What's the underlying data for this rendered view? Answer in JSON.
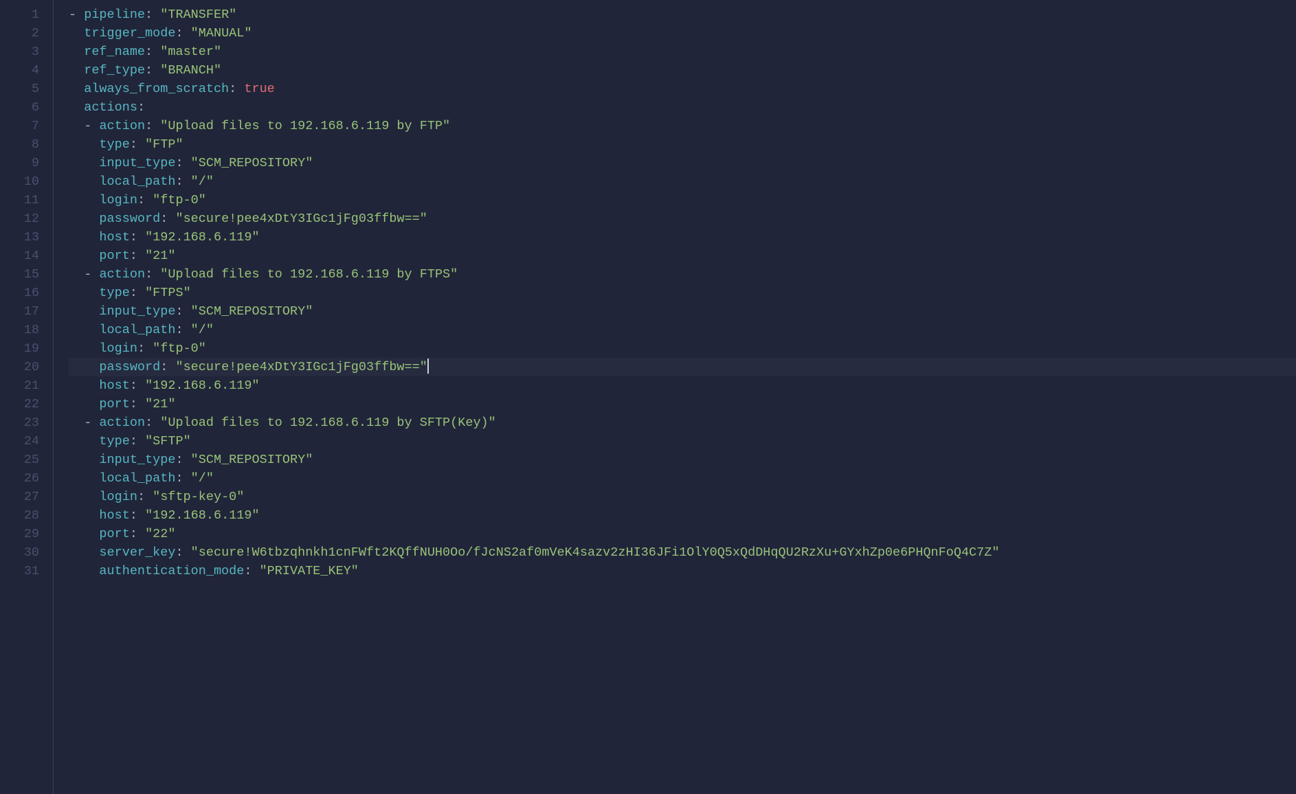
{
  "active_line": 20,
  "lines": [
    {
      "n": 1,
      "indent": 0,
      "dash": true,
      "key": "pipeline",
      "type": "str",
      "val": "TRANSFER"
    },
    {
      "n": 2,
      "indent": 1,
      "dash": false,
      "key": "trigger_mode",
      "type": "str",
      "val": "MANUAL"
    },
    {
      "n": 3,
      "indent": 1,
      "dash": false,
      "key": "ref_name",
      "type": "str",
      "val": "master"
    },
    {
      "n": 4,
      "indent": 1,
      "dash": false,
      "key": "ref_type",
      "type": "str",
      "val": "BRANCH"
    },
    {
      "n": 5,
      "indent": 1,
      "dash": false,
      "key": "always_from_scratch",
      "type": "bool",
      "val": "true"
    },
    {
      "n": 6,
      "indent": 1,
      "dash": false,
      "key": "actions",
      "type": "none",
      "val": ""
    },
    {
      "n": 7,
      "indent": 1,
      "dash": true,
      "key": "action",
      "type": "str",
      "val": "Upload files to 192.168.6.119 by FTP"
    },
    {
      "n": 8,
      "indent": 2,
      "dash": false,
      "key": "type",
      "type": "str",
      "val": "FTP"
    },
    {
      "n": 9,
      "indent": 2,
      "dash": false,
      "key": "input_type",
      "type": "str",
      "val": "SCM_REPOSITORY"
    },
    {
      "n": 10,
      "indent": 2,
      "dash": false,
      "key": "local_path",
      "type": "str",
      "val": "/"
    },
    {
      "n": 11,
      "indent": 2,
      "dash": false,
      "key": "login",
      "type": "str",
      "val": "ftp-0"
    },
    {
      "n": 12,
      "indent": 2,
      "dash": false,
      "key": "password",
      "type": "str",
      "val": "secure!pee4xDtY3IGc1jFg03ffbw=="
    },
    {
      "n": 13,
      "indent": 2,
      "dash": false,
      "key": "host",
      "type": "str",
      "val": "192.168.6.119"
    },
    {
      "n": 14,
      "indent": 2,
      "dash": false,
      "key": "port",
      "type": "str",
      "val": "21"
    },
    {
      "n": 15,
      "indent": 1,
      "dash": true,
      "key": "action",
      "type": "str",
      "val": "Upload files to 192.168.6.119 by FTPS"
    },
    {
      "n": 16,
      "indent": 2,
      "dash": false,
      "key": "type",
      "type": "str",
      "val": "FTPS"
    },
    {
      "n": 17,
      "indent": 2,
      "dash": false,
      "key": "input_type",
      "type": "str",
      "val": "SCM_REPOSITORY"
    },
    {
      "n": 18,
      "indent": 2,
      "dash": false,
      "key": "local_path",
      "type": "str",
      "val": "/"
    },
    {
      "n": 19,
      "indent": 2,
      "dash": false,
      "key": "login",
      "type": "str",
      "val": "ftp-0"
    },
    {
      "n": 20,
      "indent": 2,
      "dash": false,
      "key": "password",
      "type": "str",
      "val": "secure!pee4xDtY3IGc1jFg03ffbw=="
    },
    {
      "n": 21,
      "indent": 2,
      "dash": false,
      "key": "host",
      "type": "str",
      "val": "192.168.6.119"
    },
    {
      "n": 22,
      "indent": 2,
      "dash": false,
      "key": "port",
      "type": "str",
      "val": "21"
    },
    {
      "n": 23,
      "indent": 1,
      "dash": true,
      "key": "action",
      "type": "str",
      "val": "Upload files to 192.168.6.119 by SFTP(Key)"
    },
    {
      "n": 24,
      "indent": 2,
      "dash": false,
      "key": "type",
      "type": "str",
      "val": "SFTP"
    },
    {
      "n": 25,
      "indent": 2,
      "dash": false,
      "key": "input_type",
      "type": "str",
      "val": "SCM_REPOSITORY"
    },
    {
      "n": 26,
      "indent": 2,
      "dash": false,
      "key": "local_path",
      "type": "str",
      "val": "/"
    },
    {
      "n": 27,
      "indent": 2,
      "dash": false,
      "key": "login",
      "type": "str",
      "val": "sftp-key-0"
    },
    {
      "n": 28,
      "indent": 2,
      "dash": false,
      "key": "host",
      "type": "str",
      "val": "192.168.6.119"
    },
    {
      "n": 29,
      "indent": 2,
      "dash": false,
      "key": "port",
      "type": "str",
      "val": "22"
    },
    {
      "n": 30,
      "indent": 2,
      "dash": false,
      "key": "server_key",
      "type": "str",
      "val": "secure!W6tbzqhnkh1cnFWft2KQffNUH0Oo/fJcNS2af0mVeK4sazv2zHI36JFi1OlY0Q5xQdDHqQU2RzXu+GYxhZp0e6PHQnFoQ4C7Z"
    },
    {
      "n": 31,
      "indent": 2,
      "dash": false,
      "key": "authentication_mode",
      "type": "str",
      "val": "PRIVATE_KEY"
    }
  ]
}
